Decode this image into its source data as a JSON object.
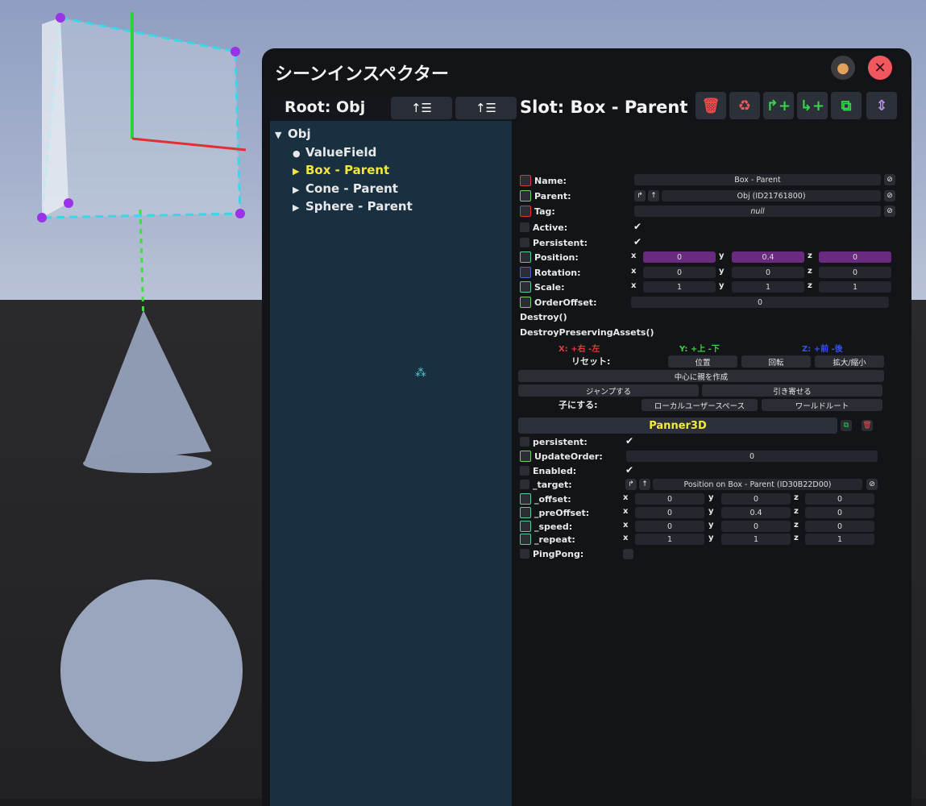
{
  "panel": {
    "title": "シーンインスペクター",
    "icons": {
      "pin": "pin-icon",
      "close": "close-icon"
    },
    "colors": {
      "accent": "#f2e53b",
      "close": "#f0575f",
      "purple": "#6a2b7e"
    }
  },
  "hierarchy": {
    "root_label": "Root: Obj",
    "items": [
      {
        "label": "Obj",
        "marker": "▼"
      },
      {
        "label": "ValueField",
        "marker": "●"
      },
      {
        "label": "Box - Parent",
        "marker": "▶"
      },
      {
        "label": "Cone - Parent",
        "marker": "▶"
      },
      {
        "label": "Sphere - Parent",
        "marker": "▶"
      }
    ]
  },
  "slot": {
    "title": "Slot: Box - Parent",
    "fields": {
      "name_label": "Name:",
      "name_value": "Box - Parent",
      "parent_label": "Parent:",
      "parent_value": "Obj (ID21761800)",
      "tag_label": "Tag:",
      "tag_value": "null",
      "active_label": "Active:",
      "persistent_label": "Persistent:",
      "position_label": "Position:",
      "position": [
        "0",
        "0.4",
        "0"
      ],
      "rotation_label": "Rotation:",
      "rotation": [
        "0",
        "0",
        "0"
      ],
      "scale_label": "Scale:",
      "scale": [
        "1",
        "1",
        "1"
      ],
      "order_label": "OrderOffset:",
      "order_value": "0"
    },
    "axes": [
      "x",
      "y",
      "z"
    ],
    "actions": {
      "destroy": "Destroy()",
      "destroy_preserving": "DestroyPreservingAssets()",
      "x_hint": "X: +右 -左",
      "y_hint": "Y: +上 -下",
      "z_hint": "Z: +前 -後",
      "reset_label": "リセット:",
      "reset_pos": "位置",
      "reset_rot": "回転",
      "reset_scale": "拡大/縮小",
      "create_parent": "中心に親を作成",
      "jump": "ジャンプする",
      "bring": "引き寄せる",
      "child_label": "子にする:",
      "local_user": "ローカルユーザースペース",
      "world_root": "ワールドルート"
    }
  },
  "component": {
    "name": "Panner3D",
    "persistent_label": "persistent:",
    "update_label": "UpdateOrder:",
    "update_value": "0",
    "enabled_label": "Enabled:",
    "target_label": "_target:",
    "target_value": "Position on Box - Parent (ID30B22D00)",
    "offset_label": "_offset:",
    "offset": [
      "0",
      "0",
      "0"
    ],
    "preoffset_label": "_preOffset:",
    "preoffset": [
      "0",
      "0.4",
      "0"
    ],
    "speed_label": "_speed:",
    "speed": [
      "0",
      "0",
      "0"
    ],
    "repeat_label": "_repeat:",
    "repeat": [
      "1",
      "1",
      "1"
    ],
    "pingpong_label": "PingPong:"
  }
}
